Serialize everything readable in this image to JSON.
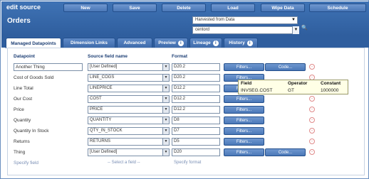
{
  "app": {
    "title": "edit source"
  },
  "toolbar": {
    "buttons": [
      {
        "label": "New"
      },
      {
        "label": "Save"
      },
      {
        "label": "Delete"
      },
      {
        "label": "Load"
      },
      {
        "label": "Wipe Data"
      },
      {
        "label": "Schedule"
      }
    ]
  },
  "page": {
    "title": "Orders",
    "source_select": "Harvested from Data",
    "source_input": "centord"
  },
  "tabs": [
    {
      "label": "Managed Datapoints",
      "active": true
    },
    {
      "label": "Dimension Links"
    },
    {
      "label": "Advanced"
    },
    {
      "label": "Preview"
    },
    {
      "label": "Lineage"
    },
    {
      "label": "History"
    }
  ],
  "columns": {
    "datapoint": "Datapoint",
    "source": "Source field name",
    "format": "Format"
  },
  "rows": [
    {
      "datapoint": "Another Thing",
      "source": "[User Defined]",
      "format": "D20.2",
      "filters": "Filters...",
      "code": "Code..."
    },
    {
      "datapoint": "Cost of Goods Sold",
      "source": "LINE_COGS",
      "format": "D20.2",
      "filters": "Filters..."
    },
    {
      "datapoint": "Line Total",
      "source": "LINEPRICE",
      "format": "D12.2",
      "filters": "Filters..."
    },
    {
      "datapoint": "Our Cost",
      "source": "COST",
      "format": "D12.2",
      "filters": "Filters..."
    },
    {
      "datapoint": "Price",
      "source": "PRICE",
      "format": "D12.2",
      "filters": "Filters..."
    },
    {
      "datapoint": "Quantity",
      "source": "QUANTITY",
      "format": "D8",
      "filters": "Filters..."
    },
    {
      "datapoint": "Quantity In Stock",
      "source": "QTY_IN_STOCK",
      "format": "D7",
      "filters": "Filters..."
    },
    {
      "datapoint": "Returns",
      "source": "RETURNS",
      "format": "D5",
      "filters": "Filters..."
    },
    {
      "datapoint": "Thing",
      "source": "[User Defined]",
      "format": "D20",
      "filters": "Filters...",
      "code": "Code..."
    }
  ],
  "new_row": {
    "datapoint": "Specify field",
    "source": "-- Select a field --",
    "format": "Specify format"
  },
  "tooltip": {
    "headers": [
      "Field",
      "Operator",
      "Constant"
    ],
    "values": [
      "INVSEG.COST",
      "GT",
      "1000000"
    ]
  },
  "colors": {
    "header": "#2f5e9e",
    "button": "#4b78b8",
    "delete_icon": "#e08a8a"
  }
}
